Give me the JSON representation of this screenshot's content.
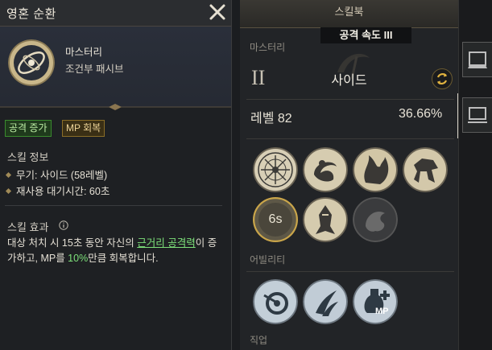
{
  "tooltip": {
    "title": "영혼 순환",
    "skill_name": "마스터리",
    "skill_type": "조건부 패시브",
    "tags": [
      "공격 증가",
      "MP 회복"
    ],
    "info_title": "스킬 정보",
    "info_items": [
      "무기: 사이드 (58레벨)",
      "재사용 대기시간: 60초"
    ],
    "effect_title": "스킬 효과",
    "effect_parts": {
      "p1": "대상 처치 시 15초 동안 자신의 ",
      "highlight1": "근거리 공격력",
      "p2": "이 증가하고, MP를 ",
      "highlight2": "10%",
      "p3": "만큼 회복합니다."
    }
  },
  "skillbook": {
    "title": "스킬북",
    "selected_skill": "공격 속도 III",
    "mastery_label": "마스터리",
    "class_roman": "II",
    "class_name": "사이드",
    "level_label": "레벨 82",
    "level_percent": "36.66%",
    "cooldown_badge": "6s",
    "ability_label": "어빌리티",
    "job_label": "직업",
    "mp_badge": "MP"
  },
  "icons": {
    "close": "close-icon",
    "info": "info-icon",
    "swap": "swap-icon"
  },
  "colors": {
    "tag_green": "#3a8b2e",
    "tag_gold": "#8a6d27",
    "highlight_green": "#7de07a"
  }
}
